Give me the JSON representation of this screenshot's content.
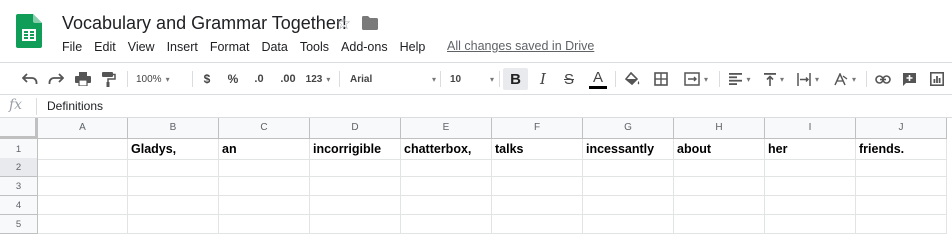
{
  "doc": {
    "title": "Vocabulary and Grammar Together!",
    "save_status": "All changes saved in Drive"
  },
  "icons": {
    "logo": "sheets-logo-icon",
    "star": "star-icon",
    "folder": "folder-icon"
  },
  "colors": {
    "brand_green": "#0f9d58",
    "text_color_underline": "#000000",
    "grid_line": "#e2e3e3",
    "header_bg": "#f8f9fa"
  },
  "menu": [
    "File",
    "Edit",
    "View",
    "Insert",
    "Format",
    "Data",
    "Tools",
    "Add-ons",
    "Help"
  ],
  "toolbar": {
    "zoom": "100%",
    "currency": "$",
    "percent": "%",
    "decrease_decimals": ".0",
    "increase_decimals": ".00",
    "more_formats": "123",
    "font": "Arial",
    "font_size": "10",
    "bold": "B",
    "italic": "I",
    "strikethrough": "S",
    "text_color": "A"
  },
  "formula_bar": {
    "fx_label": "fx",
    "value": "Definitions"
  },
  "grid": {
    "columns": [
      "A",
      "B",
      "C",
      "D",
      "E",
      "F",
      "G",
      "H",
      "I",
      "J"
    ],
    "rows": [
      "1",
      "2",
      "3",
      "4",
      "5"
    ],
    "row1_cells": [
      "",
      "Gladys,",
      "an",
      "incorrigible",
      "chatterbox,",
      "talks",
      "incessantly",
      "about",
      "her",
      "friends."
    ]
  }
}
